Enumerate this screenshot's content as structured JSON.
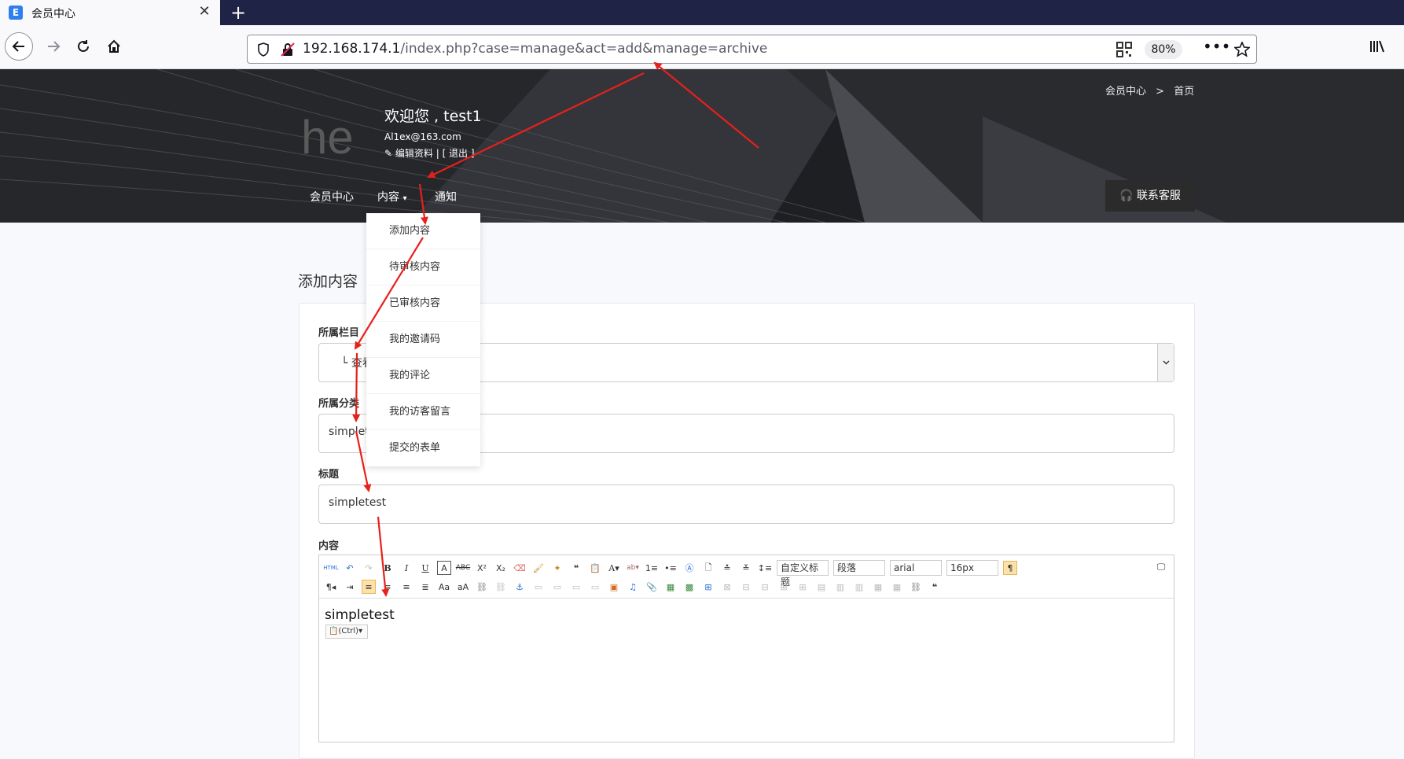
{
  "browser": {
    "tab_title": "会员中心",
    "tab_favicon": "E",
    "new_tab_label": "+",
    "url_host": "192.168.174.1",
    "url_path": "/index.php?case=manage&act=add&manage=archive",
    "zoom": "80%"
  },
  "header": {
    "logo_text": "he",
    "welcome": "欢迎您 , test1",
    "email": "Al1ex@163.com",
    "profile_links": "编辑资料 | [ 退出 ]",
    "breadcrumb": [
      "会员中心",
      ">",
      "首页"
    ],
    "menu": [
      "会员中心",
      "内容",
      "通知"
    ],
    "contact_button": "联系客服"
  },
  "dropdown": {
    "items": [
      "添加内容",
      "待审核内容",
      "已审核内容",
      "我的邀请码",
      "我的评论",
      "我的访客留言",
      "提交的表单"
    ]
  },
  "page": {
    "heading": "添加内容",
    "fields": [
      {
        "label": "所属栏目",
        "value": "└ 查看"
      },
      {
        "label": "所属分类",
        "value": "simplet"
      },
      {
        "label": "标题",
        "value": "simpletest"
      }
    ],
    "content_label": "内容",
    "editor": {
      "selects": [
        "自定义标题",
        "段落",
        "arial",
        "16px"
      ],
      "body_text": "simpletest",
      "paste_tip": "(Ctrl)"
    }
  },
  "colors": {
    "tabstrip": "#1f2345",
    "annotation_arrow": "#e8201a",
    "header_bg": "#202124"
  }
}
